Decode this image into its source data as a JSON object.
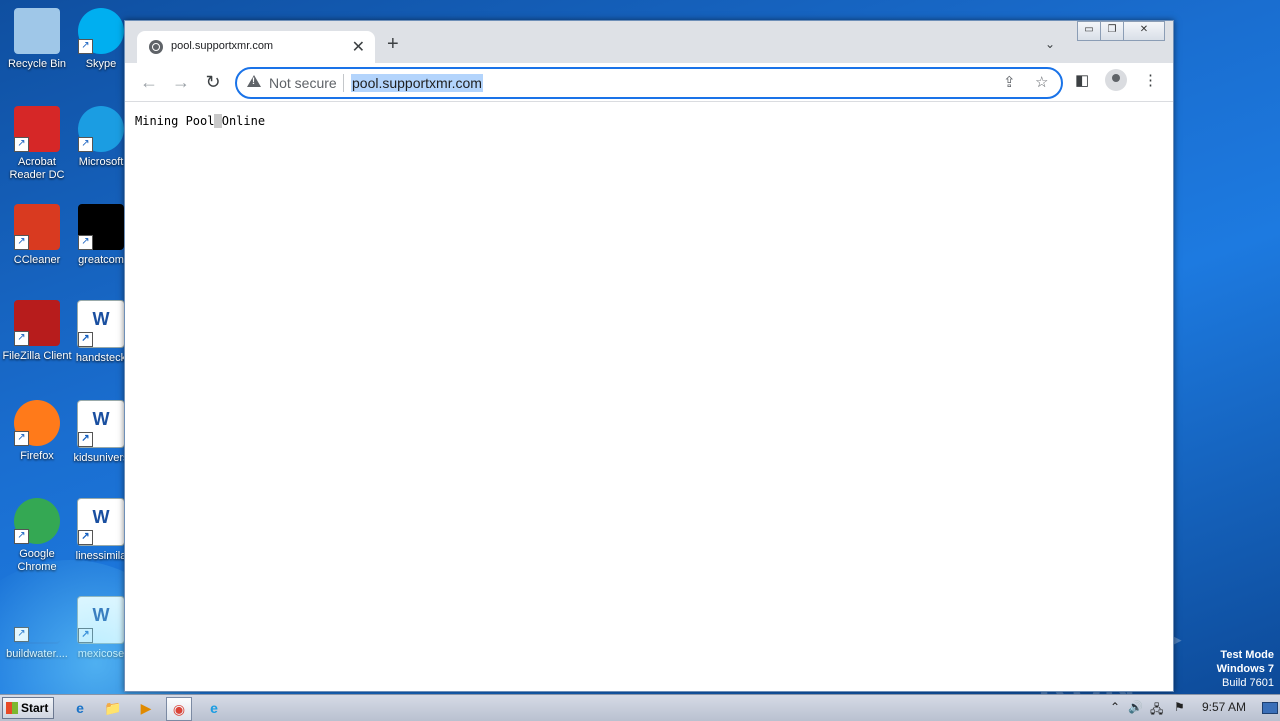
{
  "desktop": {
    "icons_col1": [
      {
        "label": "Recycle Bin",
        "icon": "recycle-bin-icon",
        "color": "#9fc7e8"
      },
      {
        "label": "Acrobat Reader DC",
        "icon": "acrobat-icon",
        "color": "#d62727"
      },
      {
        "label": "CCleaner",
        "icon": "ccleaner-icon",
        "color": "#d93a20"
      },
      {
        "label": "FileZilla Client",
        "icon": "filezilla-icon",
        "color": "#b71c1c"
      },
      {
        "label": "Firefox",
        "icon": "firefox-icon",
        "color": "#ff7a1a"
      },
      {
        "label": "Google Chrome",
        "icon": "chrome-icon",
        "color": "#34a853"
      },
      {
        "label": "buildwater....",
        "icon": "file-icon",
        "color": "#1e6fd0"
      }
    ],
    "icons_col2": [
      {
        "label": "Skype",
        "icon": "skype-icon",
        "color": "#00aff0"
      },
      {
        "label": "Microsoft",
        "icon": "edge-icon",
        "color": "#1b9de2"
      },
      {
        "label": "greatcom",
        "icon": "black-file-icon",
        "color": "#000000"
      },
      {
        "label": "handsteck",
        "icon": "word-doc-icon",
        "color": "#ffffff"
      },
      {
        "label": "kidsunivers",
        "icon": "word-doc-icon",
        "color": "#ffffff"
      },
      {
        "label": "linessimila",
        "icon": "word-doc-icon",
        "color": "#ffffff"
      },
      {
        "label": "mexicose",
        "icon": "word-doc-icon",
        "color": "#ffffff"
      }
    ],
    "watermark": "ANY ▷ RUN",
    "test_mode": [
      "Test Mode",
      "Windows 7",
      "Build 7601"
    ]
  },
  "browser": {
    "tab_title": "pool.supportxmr.com",
    "tab_close": "✕",
    "new_tab": "+",
    "tab_search": "⌄",
    "window_controls": {
      "minimize": "▭",
      "restore": "❐",
      "close": "✕"
    },
    "nav": {
      "back": "←",
      "forward": "→",
      "reload": "↻"
    },
    "security_label": "Not secure",
    "url": "pool.supportxmr.com",
    "icons": {
      "share": "⇪",
      "bookmark": "☆",
      "sidepanel": "◧",
      "menu": "⋮"
    },
    "page_text_before": "Mining Pool",
    "page_text_caret": " ",
    "page_text_after": "Online"
  },
  "taskbar": {
    "start_label": "Start",
    "quick_icons": [
      "ie-icon",
      "explorer-icon",
      "media-player-icon",
      "chrome-icon",
      "edge-icon"
    ],
    "quick_glyphs": [
      "e",
      "📁",
      "▶",
      "◉",
      "e"
    ],
    "tray_glyphs": [
      "⌃",
      "🔊",
      "🖧",
      "⚑"
    ],
    "clock": "9:57 AM"
  }
}
